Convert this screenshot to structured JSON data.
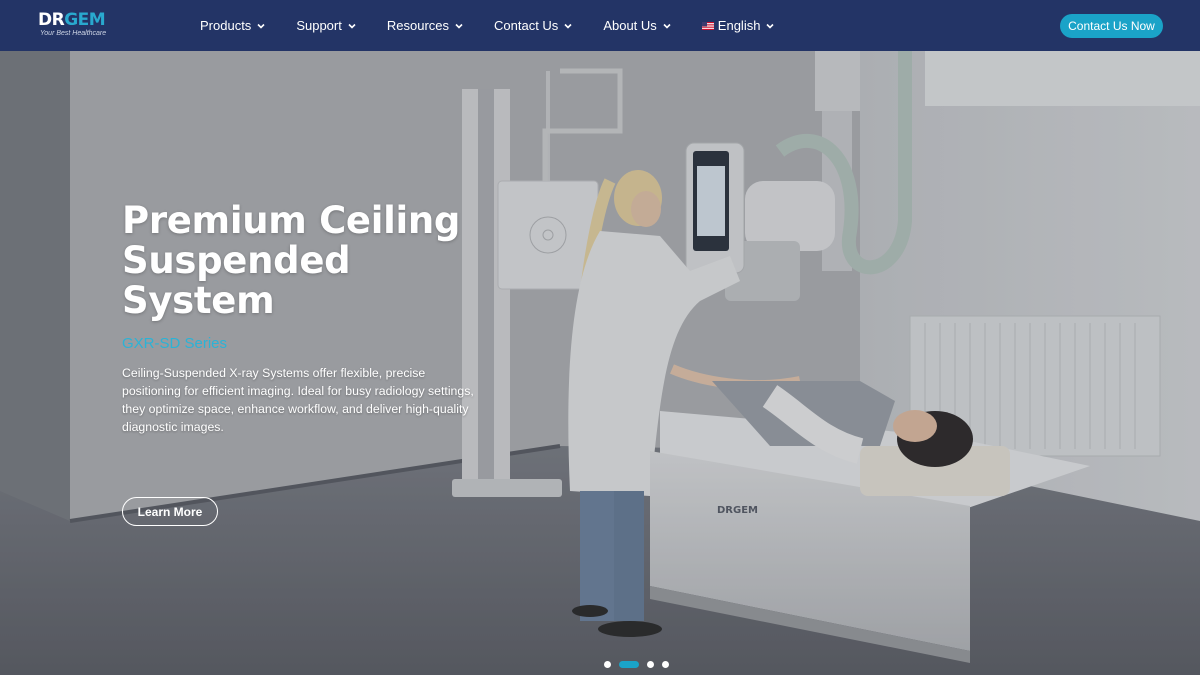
{
  "brand": {
    "logo_dr": "DR",
    "logo_gem": "GEM",
    "tagline": "Your Best Healthcare"
  },
  "nav": {
    "items": [
      {
        "label": "Products"
      },
      {
        "label": "Support"
      },
      {
        "label": "Resources"
      },
      {
        "label": "Contact Us"
      },
      {
        "label": "About Us"
      },
      {
        "label": "English"
      }
    ],
    "cta_label": "Contact Us Now"
  },
  "hero": {
    "title_line1": "Premium Ceiling",
    "title_line2": "Suspended",
    "title_line3": "System",
    "series": "GXR-SD Series",
    "description": "Ceiling-Suspended X-ray Systems offer flexible, precise positioning for efficient imaging. Ideal for busy radiology settings, they optimize space, enhance workflow, and deliver high-quality diagnostic images.",
    "button_label": "Learn More",
    "equipment_brand": "DRGEM",
    "slides_total": 4,
    "slide_active": 2
  },
  "colors": {
    "header_bg": "#233466",
    "accent": "#1aa3c8",
    "series_text": "#2bb3d6"
  }
}
